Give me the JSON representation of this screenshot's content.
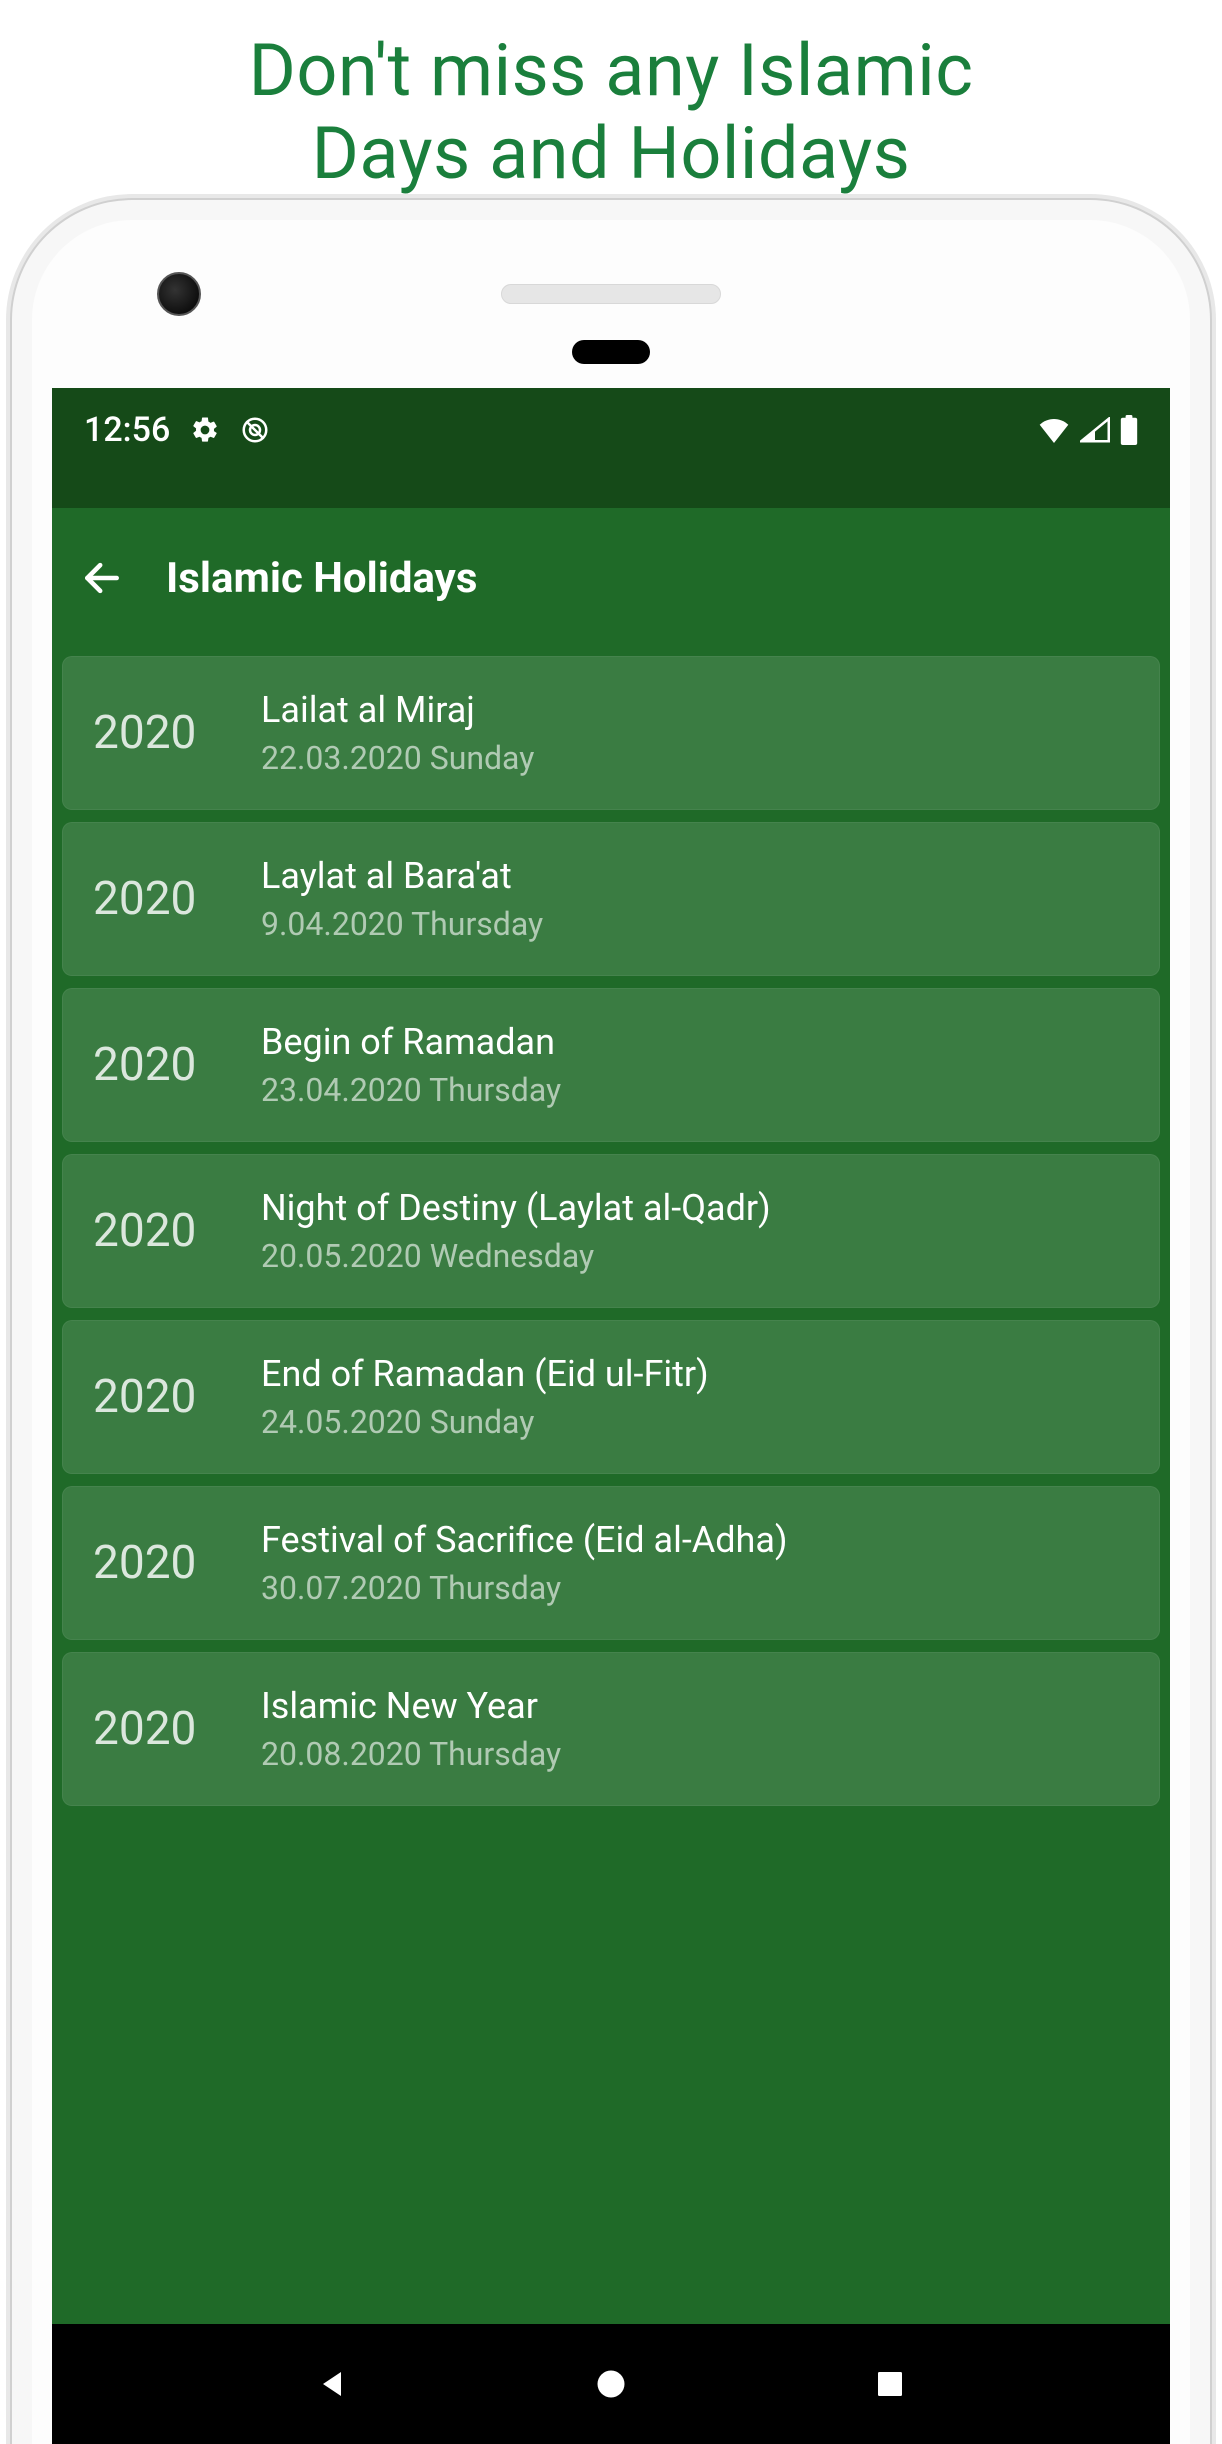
{
  "promo": {
    "line1": "Don't miss any Islamic",
    "line2": "Days and Holidays"
  },
  "statusBar": {
    "time": "12:56"
  },
  "appBar": {
    "title": "Islamic Holidays"
  },
  "holidays": [
    {
      "year": "2020",
      "name": "Lailat al Miraj",
      "date": "22.03.2020 Sunday"
    },
    {
      "year": "2020",
      "name": "Laylat al Bara'at",
      "date": "9.04.2020 Thursday"
    },
    {
      "year": "2020",
      "name": "Begin of Ramadan",
      "date": "23.04.2020 Thursday"
    },
    {
      "year": "2020",
      "name": "Night of Destiny (Laylat al-Qadr)",
      "date": "20.05.2020 Wednesday"
    },
    {
      "year": "2020",
      "name": "End of Ramadan (Eid ul-Fitr)",
      "date": "24.05.2020 Sunday"
    },
    {
      "year": "2020",
      "name": "Festival of Sacrifice (Eid al-Adha)",
      "date": "30.07.2020 Thursday"
    },
    {
      "year": "2020",
      "name": "Islamic New Year",
      "date": "20.08.2020 Thursday"
    }
  ]
}
